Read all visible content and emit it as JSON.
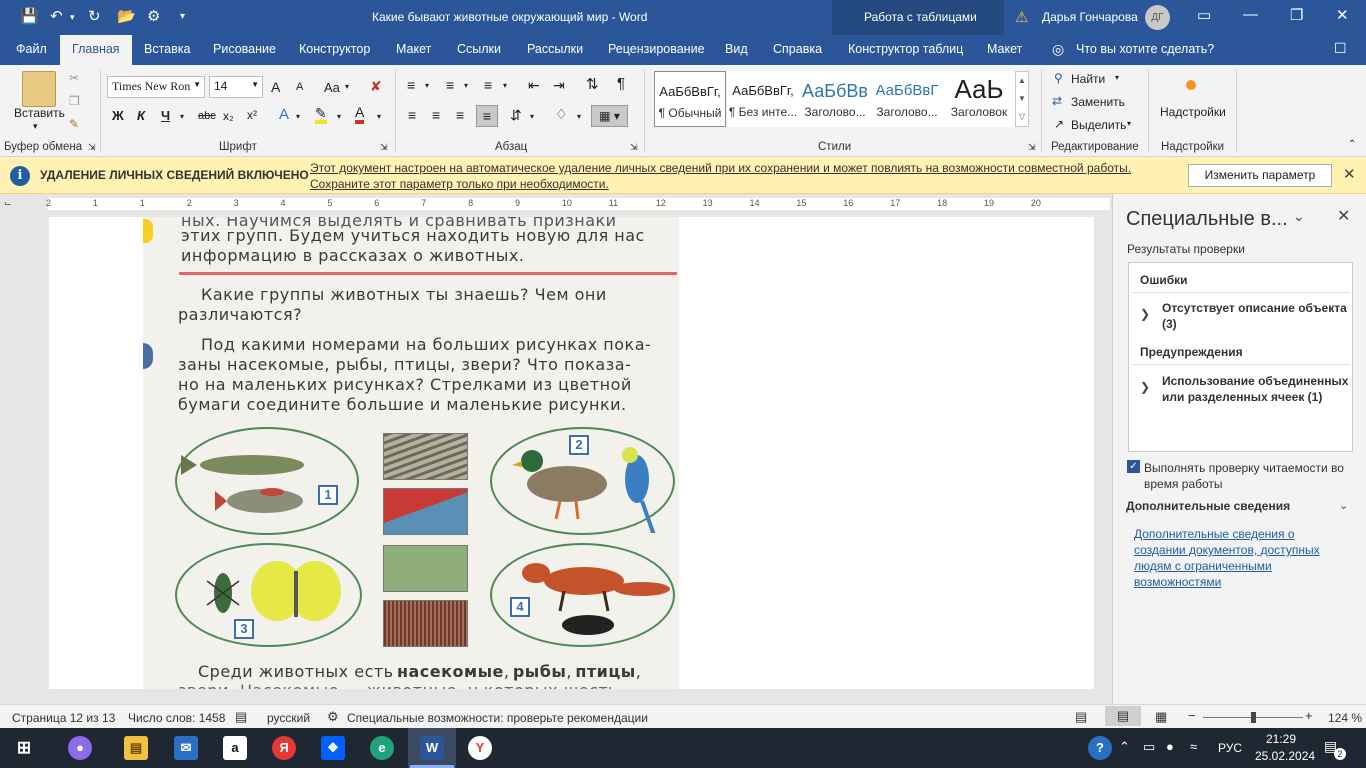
{
  "titlebar": {
    "title": "Какие бывают животные окружающий мир  -  Word",
    "table_tools": "Работа с таблицами",
    "user": "Дарья Гончарова",
    "initials": "ДГ"
  },
  "tabs": [
    "Файл",
    "Главная",
    "Вставка",
    "Рисование",
    "Конструктор",
    "Макет",
    "Ссылки",
    "Рассылки",
    "Рецензирование",
    "Вид",
    "Справка",
    "Конструктор таблиц",
    "Макет"
  ],
  "tell_me": "Что вы хотите сделать?",
  "ribbon": {
    "clipboard": {
      "paste": "Вставить",
      "label": "Буфер обмена"
    },
    "font": {
      "name": "Times New Ron",
      "size": "14",
      "label": "Шрифт",
      "bold": "Ж",
      "italic": "К",
      "underline": "Ч",
      "strike": "abc",
      "sub": "x₂",
      "sup": "x²",
      "case": "Aa",
      "grow": "A",
      "shrink": "A"
    },
    "paragraph": {
      "label": "Абзац"
    },
    "styles": {
      "label": "Стили",
      "items": [
        {
          "sample": "АаБбВвГг,",
          "name": "¶ Обычный"
        },
        {
          "sample": "АаБбВвГг,",
          "name": "¶ Без инте..."
        },
        {
          "sample": "АаБбВв",
          "name": "Заголово..."
        },
        {
          "sample": "АаБбВвГ",
          "name": "Заголово..."
        },
        {
          "sample": "АаЬ",
          "name": "Заголовок"
        }
      ]
    },
    "editing": {
      "find": "Найти",
      "replace": "Заменить",
      "select": "Выделить",
      "label": "Редактирование"
    },
    "addins": {
      "button": "Надстройки",
      "label": "Надстройки"
    }
  },
  "infobar": {
    "title": "УДАЛЕНИЕ ЛИЧНЫХ СВЕДЕНИЙ ВКЛЮЧЕНО",
    "line1": "Этот документ настроен на автоматическое удаление личных сведений при их сохранении и может повлиять на возможности совместной работы.",
    "line2": "Сохраните этот параметр только при необходимости.",
    "button": "Изменить параметр"
  },
  "ruler": [
    "2",
    "1",
    "1",
    "2",
    "3",
    "4",
    "5",
    "6",
    "7",
    "8",
    "9",
    "10",
    "11",
    "12",
    "13",
    "14",
    "15",
    "16",
    "17",
    "18",
    "19",
    "20"
  ],
  "scan": {
    "line0": "ных. Научимся выделять и сравнивать признаки",
    "line1": "этих групп. Будем учиться находить новую для нас",
    "line2": "информацию в рассказах о животных.",
    "q1a": "Какие группы животных ты знаешь? Чем они",
    "q1b": "различаются?",
    "q2a": "Под какими номерами на больших рисунках пока-",
    "q2b": "заны насекомые, рыбы, птицы, звери? Что показа-",
    "q2c": "но на маленьких рисунках? Стрелками из цветной",
    "q2d": "бумаги соедините большие и маленькие рисунки.",
    "bottom_a": "Среди животных есть",
    "bottom_b": "насекомые",
    "bottom_c": "рыбы",
    "bottom_d": "птицы",
    "bottom_e": "звери. Насекомые — животные, у которых шесть",
    "nums": [
      "1",
      "2",
      "3",
      "4"
    ]
  },
  "pane": {
    "title": "Специальные в...",
    "results_label": "Результаты проверки",
    "errors_head": "Ошибки",
    "error_item": "Отсутствует описание объекта (3)",
    "warnings_head": "Предупреждения",
    "warning_item": "Использование объединенных или разделенных ячеек (1)",
    "check_label": "Выполнять проверку читаемости во время работы",
    "addinfo_title": "Дополнительные сведения",
    "addinfo_link": "Дополнительные сведения о создании документов, доступных людям с ограниченными возможностями"
  },
  "statusbar": {
    "page": "Страница 12 из 13",
    "words": "Число слов: 1458",
    "lang": "русский",
    "access": "Специальные возможности: проверьте рекомендации",
    "zoom": "124 %"
  },
  "taskbar": {
    "lang": "РУС",
    "time": "21:29",
    "date": "25.02.2024",
    "notif": "2"
  },
  "colors": {
    "accent": "#2b579a",
    "infobar": "#fff2b3",
    "taskbar": "#1f2733"
  }
}
